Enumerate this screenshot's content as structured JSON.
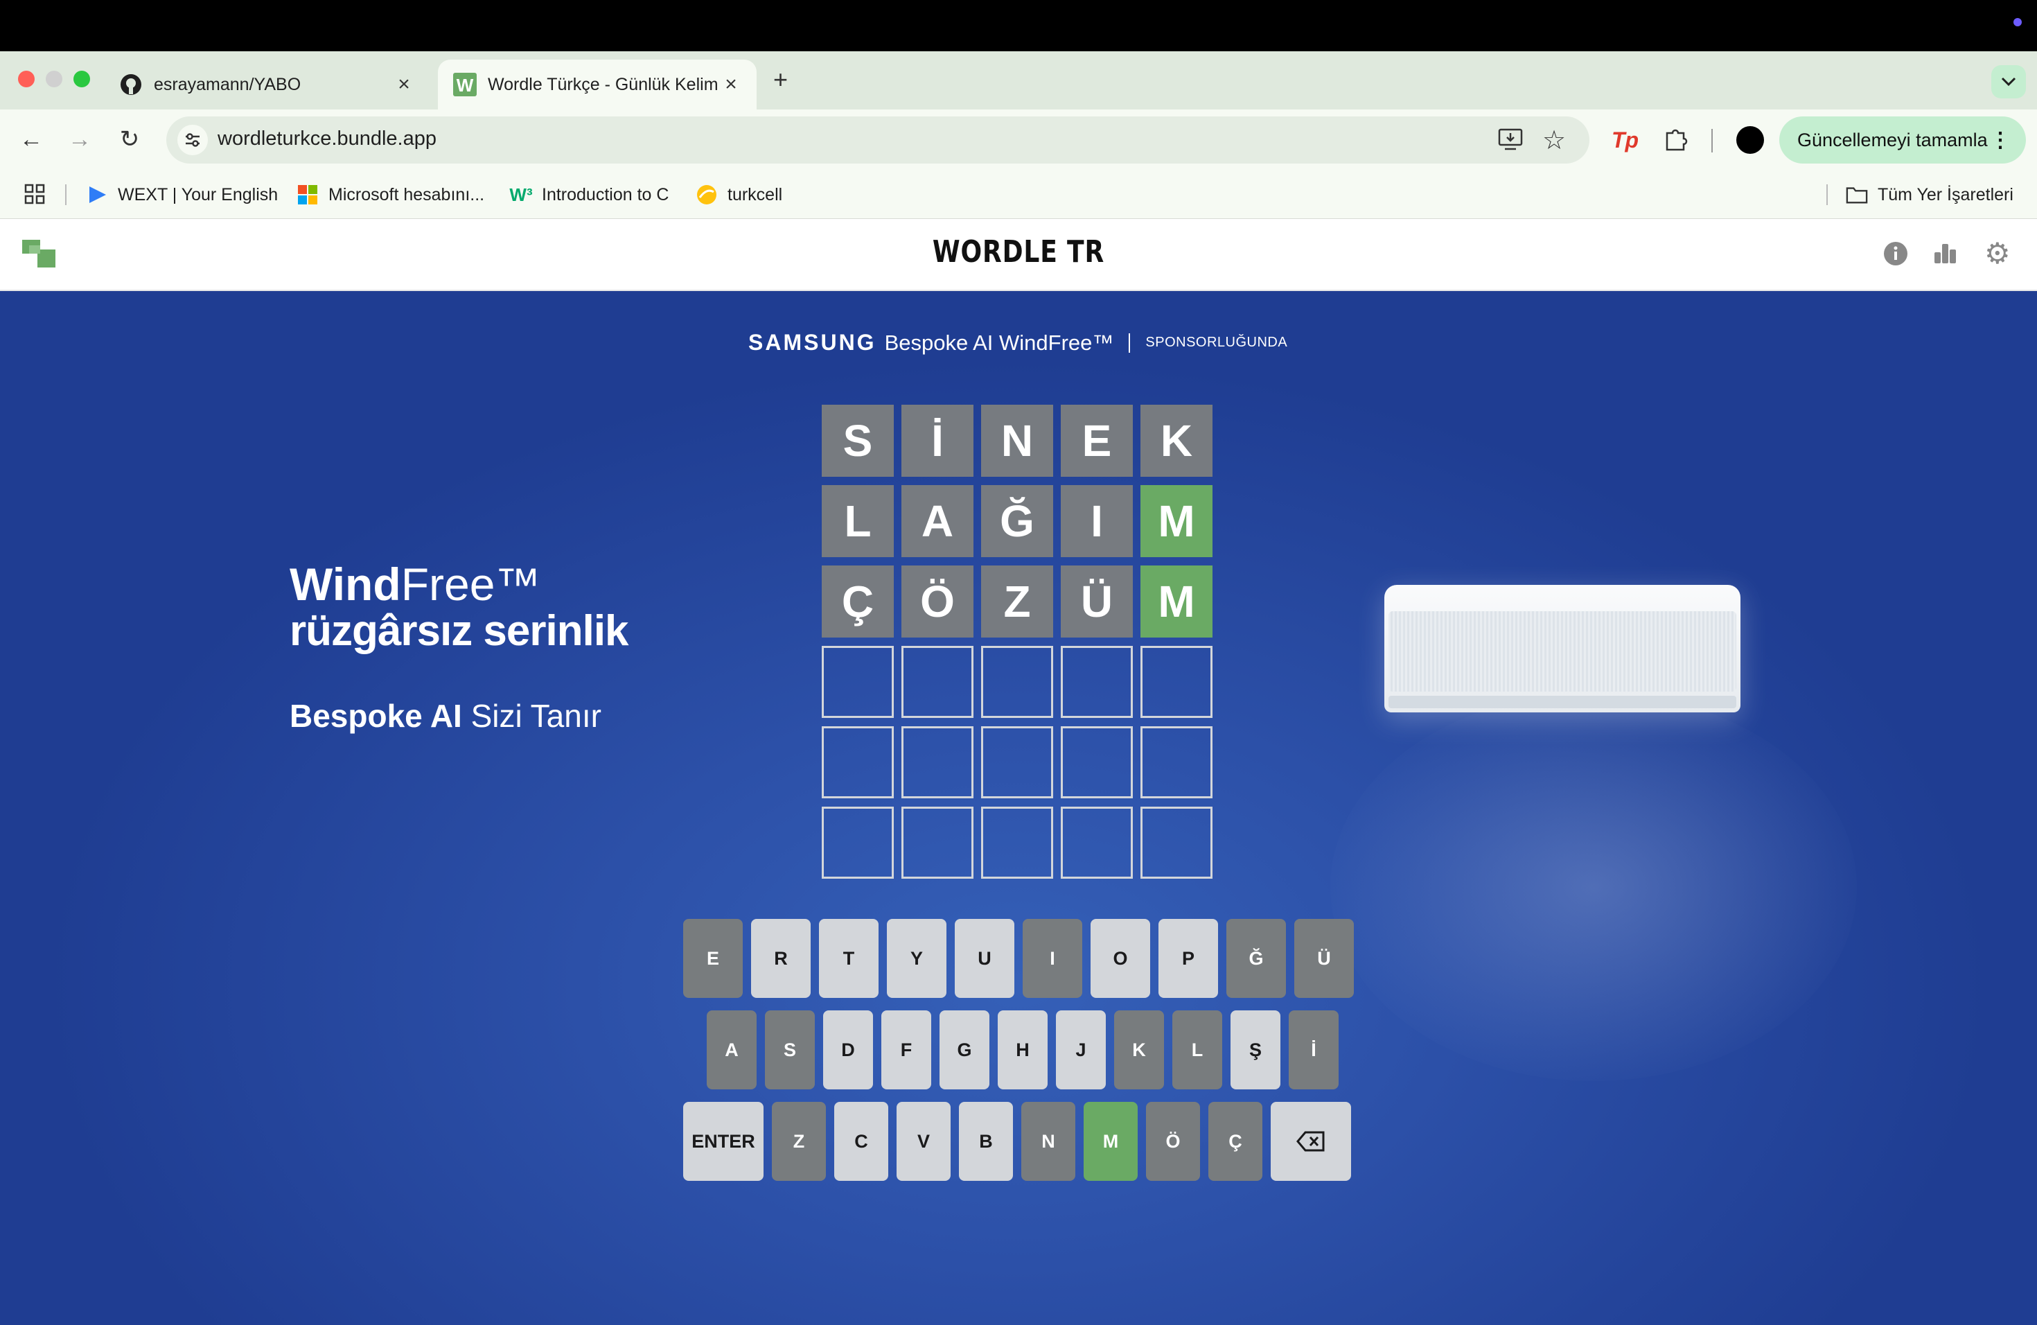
{
  "browser": {
    "tabs": [
      {
        "title": "esrayamann/YABO",
        "favicon": "github-icon",
        "active": false
      },
      {
        "title": "Wordle Türkçe - Günlük Kelim",
        "favicon": "wordle-w-icon",
        "active": true
      }
    ],
    "url": "wordleturkce.bundle.app",
    "update_button": "Güncellemeyi tamamla",
    "bookmarks": [
      {
        "label": "WEXT | Your English",
        "icon": "wext-icon"
      },
      {
        "label": "Microsoft hesabını...",
        "icon": "microsoft-icon"
      },
      {
        "label": "Introduction to C",
        "icon": "w3schools-icon"
      },
      {
        "label": "turkcell",
        "icon": "turkcell-icon"
      }
    ],
    "all_bookmarks": "Tüm Yer İşaretleri"
  },
  "page": {
    "title": "WORDLE TR",
    "sponsor": {
      "brand": "SAMSUNG",
      "product": "Bespoke AI WindFree™",
      "tag": "SPONSORLUĞUNDA"
    },
    "ad": {
      "line1_bold": "Wind",
      "line1_light": "Free™",
      "line2": "rüzgârsız serinlik",
      "line3_bold": "Bespoke AI",
      "line3_light": " Sizi Tanır"
    }
  },
  "grid": {
    "rows": [
      [
        {
          "l": "S",
          "s": "gray"
        },
        {
          "l": "İ",
          "s": "gray"
        },
        {
          "l": "N",
          "s": "gray"
        },
        {
          "l": "E",
          "s": "gray"
        },
        {
          "l": "K",
          "s": "gray"
        }
      ],
      [
        {
          "l": "L",
          "s": "gray"
        },
        {
          "l": "A",
          "s": "gray"
        },
        {
          "l": "Ğ",
          "s": "gray"
        },
        {
          "l": "I",
          "s": "gray"
        },
        {
          "l": "M",
          "s": "green"
        }
      ],
      [
        {
          "l": "Ç",
          "s": "gray"
        },
        {
          "l": "Ö",
          "s": "gray"
        },
        {
          "l": "Z",
          "s": "gray"
        },
        {
          "l": "Ü",
          "s": "gray"
        },
        {
          "l": "M",
          "s": "green"
        }
      ],
      [
        {
          "l": "",
          "s": "empty"
        },
        {
          "l": "",
          "s": "empty"
        },
        {
          "l": "",
          "s": "empty"
        },
        {
          "l": "",
          "s": "empty"
        },
        {
          "l": "",
          "s": "empty"
        }
      ],
      [
        {
          "l": "",
          "s": "empty"
        },
        {
          "l": "",
          "s": "empty"
        },
        {
          "l": "",
          "s": "empty"
        },
        {
          "l": "",
          "s": "empty"
        },
        {
          "l": "",
          "s": "empty"
        }
      ],
      [
        {
          "l": "",
          "s": "empty"
        },
        {
          "l": "",
          "s": "empty"
        },
        {
          "l": "",
          "s": "empty"
        },
        {
          "l": "",
          "s": "empty"
        },
        {
          "l": "",
          "s": "empty"
        }
      ]
    ]
  },
  "keyboard": {
    "rows": [
      [
        {
          "k": "E",
          "s": "gray"
        },
        {
          "k": "R",
          "s": ""
        },
        {
          "k": "T",
          "s": ""
        },
        {
          "k": "Y",
          "s": ""
        },
        {
          "k": "U",
          "s": ""
        },
        {
          "k": "I",
          "s": "gray"
        },
        {
          "k": "O",
          "s": ""
        },
        {
          "k": "P",
          "s": ""
        },
        {
          "k": "Ğ",
          "s": "gray"
        },
        {
          "k": "Ü",
          "s": "gray"
        }
      ],
      [
        {
          "k": "A",
          "s": "gray"
        },
        {
          "k": "S",
          "s": "gray"
        },
        {
          "k": "D",
          "s": ""
        },
        {
          "k": "F",
          "s": ""
        },
        {
          "k": "G",
          "s": ""
        },
        {
          "k": "H",
          "s": ""
        },
        {
          "k": "J",
          "s": ""
        },
        {
          "k": "K",
          "s": "gray"
        },
        {
          "k": "L",
          "s": "gray"
        },
        {
          "k": "Ş",
          "s": ""
        },
        {
          "k": "İ",
          "s": "gray"
        }
      ],
      [
        {
          "k": "ENTER",
          "s": ""
        },
        {
          "k": "Z",
          "s": "gray"
        },
        {
          "k": "C",
          "s": ""
        },
        {
          "k": "V",
          "s": ""
        },
        {
          "k": "B",
          "s": ""
        },
        {
          "k": "N",
          "s": "gray"
        },
        {
          "k": "M",
          "s": "green"
        },
        {
          "k": "Ö",
          "s": "gray"
        },
        {
          "k": "Ç",
          "s": "gray"
        },
        {
          "k": "",
          "s": "",
          "icon": "backspace-icon"
        }
      ]
    ]
  },
  "colors": {
    "correct": "#6aaa64",
    "absent": "#787c7e",
    "unused": "#d3d6da",
    "background": "#2c50a8"
  }
}
